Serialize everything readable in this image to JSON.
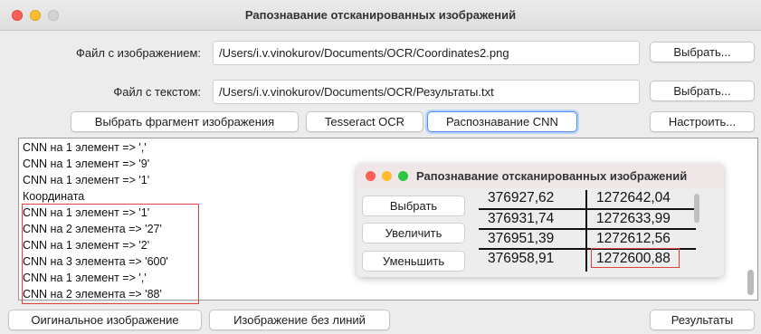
{
  "window": {
    "title": "Рапознавание отсканированных изображений"
  },
  "image_file": {
    "label": "Файл с изображением:",
    "value": "/Users/i.v.vinokurov/Documents/OCR/Coordinates2.png",
    "button": "Выбрать..."
  },
  "text_file": {
    "label": "Файл с текстом:",
    "value": "/Users/i.v.vinokurov/Documents/OCR/Результаты.txt",
    "button": "Выбрать..."
  },
  "toolbar": {
    "select_fragment": "Выбрать фрагмент изображения",
    "tesseract": "Tesseract OCR",
    "cnn": "Распознавание CNN",
    "configure": "Настроить..."
  },
  "log_lines": [
    "CNN на 1 элемент => ','",
    "CNN на 1 элемент => '9'",
    "CNN на 1 элемент => '1'",
    "Координата",
    "CNN на 1 элемент => '1'",
    "CNN на 2 элемента => '27'",
    "CNN на 1 элемент => '2'",
    "CNN на 3 элемента => '600'",
    "CNN на 1 элемент => ','",
    "CNN на 2 элемента => '88'"
  ],
  "bottom": {
    "original": "Оигинальное изображение",
    "no_lines": "Изображение без линий",
    "results": "Результаты"
  },
  "subwindow": {
    "title": "Рапознавание отсканированных изображений",
    "buttons": [
      "Выбрать",
      "Увеличить",
      "Уменьшить"
    ],
    "rows": [
      [
        "376927,62",
        "1272642,04"
      ],
      [
        "376931,74",
        "1272633,99"
      ],
      [
        "376951,39",
        "1272612,56"
      ],
      [
        "376958,91",
        "1272600,88"
      ]
    ]
  },
  "colors": {
    "highlight": "#e0413a",
    "focus": "#4d90fe"
  }
}
